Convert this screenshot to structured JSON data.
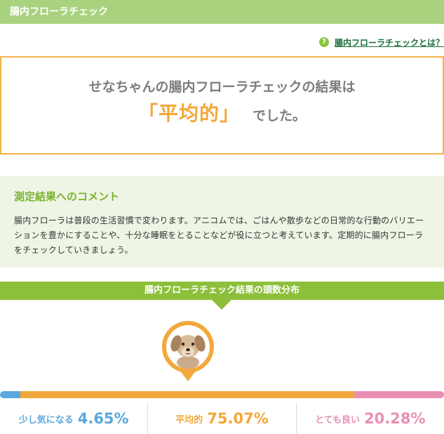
{
  "header": {
    "title": "腸内フローラチェック"
  },
  "help_link": {
    "icon": "?",
    "label": "腸内フローラチェックとは？",
    "color": "#1b6e3a"
  },
  "result": {
    "line1": "せなちゃんの腸内フローラチェックの結果は",
    "value": "「平均的」",
    "suffix": "でした。",
    "accent_color": "#f2a83b",
    "border_color": "#f2b24c"
  },
  "comment": {
    "title": "測定結果へのコメント",
    "body": "腸内フローラは普段の生活習慣で変わります。アニコムでは、ごはんや散歩などの日常的な行動のバリエーションを豊かにすることや、十分な睡眠をとることなどが役に立つと考えています。定期的に腸内フローラをチェックしていきましょう。"
  },
  "distribution": {
    "title": "腸内フローラチェック結果の頭数分布",
    "header_color": "#8cbf3a",
    "categories": [
      {
        "label": "少し気になる",
        "value": "4.65%",
        "percent": 4.65,
        "color": "#5aa9dc"
      },
      {
        "label": "平均的",
        "value": "75.07%",
        "percent": 75.07,
        "color": "#f2a83b"
      },
      {
        "label": "とても良い",
        "value": "20.28%",
        "percent": 20.28,
        "color": "#e98fb4"
      }
    ],
    "marker_position_percent": 42.3
  }
}
